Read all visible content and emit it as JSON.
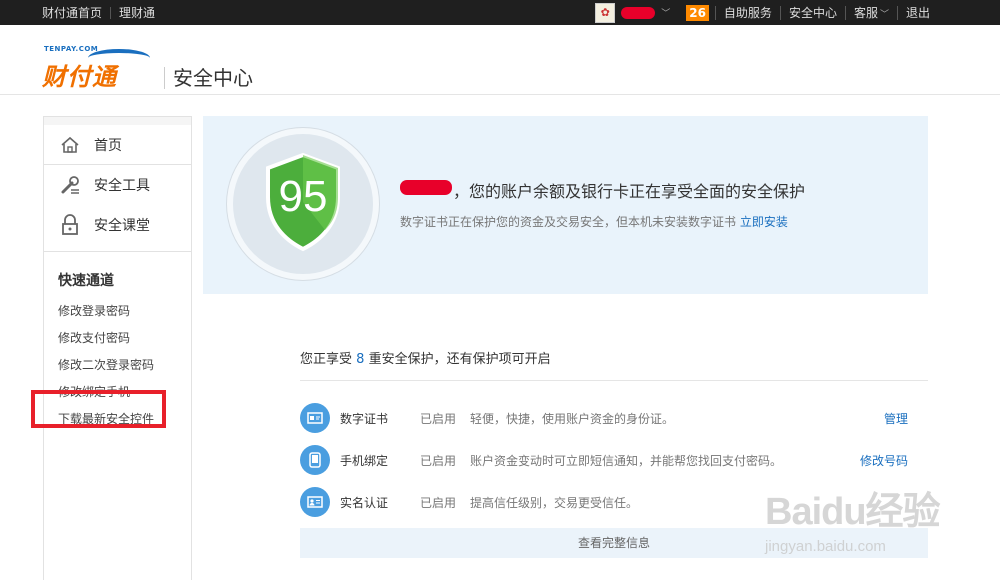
{
  "topbar": {
    "left_links": [
      "财付通首页",
      "理财通"
    ],
    "notification_count": "26",
    "right_links": [
      "自助服务",
      "安全中心",
      "客服",
      "退出"
    ]
  },
  "header": {
    "logo_small": "TENPAY.COM",
    "logo_text": "财付通",
    "section_title": "安全中心"
  },
  "sidebar": {
    "nav": [
      {
        "label": "首页",
        "icon": "home-icon"
      },
      {
        "label": "安全工具",
        "icon": "tools-icon"
      },
      {
        "label": "安全课堂",
        "icon": "lock-icon"
      }
    ],
    "quick_title": "快速通道",
    "quick_links": [
      "修改登录密码",
      "修改支付密码",
      "修改二次登录密码",
      "修改绑定手机",
      "下载最新安全控件"
    ]
  },
  "banner": {
    "score": "95",
    "headline": "，您的账户余额及银行卡正在享受全面的安全保护",
    "subline": "数字证书正在保护您的资金及交易安全，但本机未安装数字证书",
    "install_link": "立即安装"
  },
  "protection": {
    "summary_prefix": "您正享受",
    "summary_count": "8",
    "summary_suffix": "重安全保护，还有保护项可开启",
    "rows": [
      {
        "name": "数字证书",
        "status": "已启用",
        "desc": "轻便，快捷，使用账户资金的身份证。",
        "action": "管理",
        "icon": "certificate-icon"
      },
      {
        "name": "手机绑定",
        "status": "已启用",
        "desc": "账户资金变动时可立即短信通知，并能帮您找回支付密码。",
        "action": "修改号码",
        "icon": "phone-icon"
      },
      {
        "name": "实名认证",
        "status": "已启用",
        "desc": "提高信任级别，交易更受信任。",
        "action": "",
        "icon": "id-card-icon"
      }
    ],
    "view_full": "查看完整信息"
  },
  "watermark": {
    "brand": "Baidu经验",
    "url": "jingyan.baidu.com"
  },
  "colors": {
    "accent_blue": "#1a6fbf",
    "logo_orange": "#f07000",
    "highlight_red": "#e8202a",
    "shield_green": "#4cae3c"
  }
}
